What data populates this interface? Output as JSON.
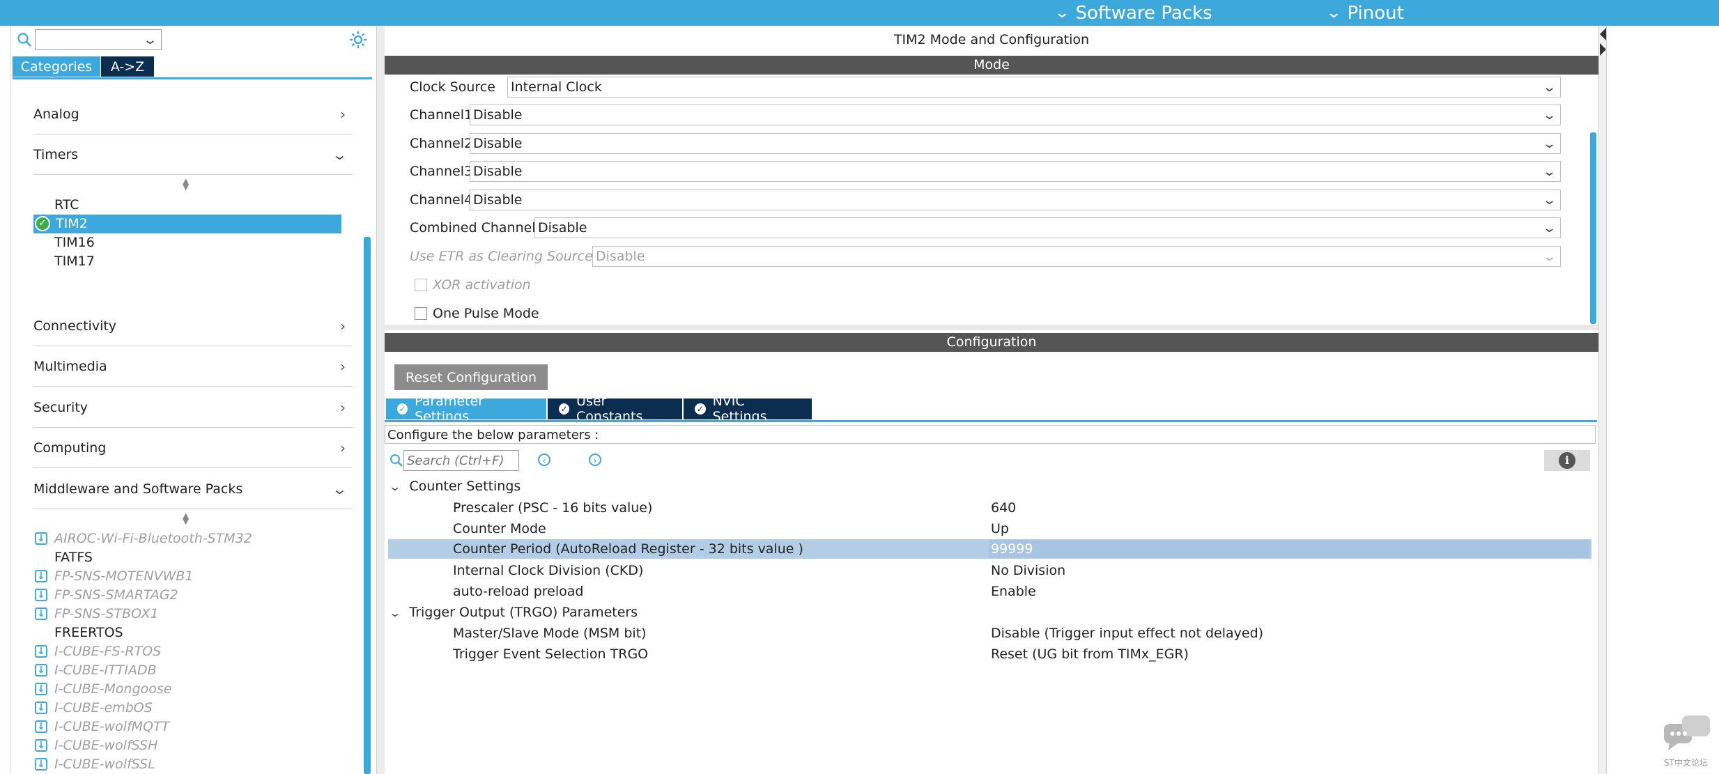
{
  "topbar": {
    "software_packs": "Software Packs",
    "pinout": "Pinout"
  },
  "left": {
    "search_placeholder": "",
    "tabs": {
      "categories": "Categories",
      "az": "A->Z"
    },
    "categories": {
      "analog": "Analog",
      "timers": "Timers",
      "connectivity": "Connectivity",
      "multimedia": "Multimedia",
      "security": "Security",
      "computing": "Computing",
      "middleware": "Middleware and Software Packs"
    },
    "timers_items": [
      "RTC",
      "TIM2",
      "TIM16",
      "TIM17"
    ],
    "middleware_items": [
      {
        "label": "AIROC-Wi-Fi-Bluetooth-STM32",
        "dim": true
      },
      {
        "label": "FATFS",
        "dim": false
      },
      {
        "label": "FP-SNS-MOTENVWB1",
        "dim": true
      },
      {
        "label": "FP-SNS-SMARTAG2",
        "dim": true
      },
      {
        "label": "FP-SNS-STBOX1",
        "dim": true
      },
      {
        "label": "FREERTOS",
        "dim": false
      },
      {
        "label": "I-CUBE-FS-RTOS",
        "dim": true
      },
      {
        "label": "I-CUBE-ITTIADB",
        "dim": true
      },
      {
        "label": "I-CUBE-Mongoose",
        "dim": true
      },
      {
        "label": "I-CUBE-embOS",
        "dim": true
      },
      {
        "label": "I-CUBE-wolfMQTT",
        "dim": true
      },
      {
        "label": "I-CUBE-wolfSSH",
        "dim": true
      },
      {
        "label": "I-CUBE-wolfSSL",
        "dim": true
      }
    ]
  },
  "main": {
    "title": "TIM2 Mode and Configuration",
    "mode_header": "Mode",
    "mode": {
      "clock_source_label": "Clock Source",
      "clock_source_value": "Internal Clock",
      "channel1_label": "Channel1",
      "channel1_value": "Disable",
      "channel2_label": "Channel2",
      "channel2_value": "Disable",
      "channel3_label": "Channel3",
      "channel3_value": "Disable",
      "channel4_label": "Channel4",
      "channel4_value": "Disable",
      "combined_label": "Combined Channels",
      "combined_value": "Disable",
      "etr_label": "Use ETR as Clearing Source",
      "etr_value": "Disable",
      "xor_label": "XOR activation",
      "one_pulse_label": "One Pulse Mode"
    },
    "config_header": "Configuration",
    "reset_button": "Reset Configuration",
    "tabs": {
      "parameter": "Parameter Settings",
      "user_constants": "User Constants",
      "nvic": "NVIC Settings"
    },
    "configure_text": "Configure the below parameters :",
    "search_placeholder": "Search (Ctrl+F)",
    "groups": {
      "counter": "Counter Settings",
      "trgo": "Trigger Output (TRGO) Parameters"
    },
    "counter_params": [
      {
        "name": "Prescaler (PSC - 16 bits value)",
        "value": "640"
      },
      {
        "name": "Counter Mode",
        "value": "Up"
      },
      {
        "name": "Counter Period (AutoReload Register - 32 bits value )",
        "value": "99999"
      },
      {
        "name": "Internal Clock Division (CKD)",
        "value": "No Division"
      },
      {
        "name": "auto-reload preload",
        "value": "Enable"
      }
    ],
    "trgo_params": [
      {
        "name": "Master/Slave Mode (MSM bit)",
        "value": "Disable (Trigger input effect not delayed)"
      },
      {
        "name": "Trigger Event Selection TRGO",
        "value": "Reset (UG bit from TIMx_EGR)"
      }
    ]
  },
  "watermark": "ST中文论坛",
  "colors": {
    "accent": "#3ca8dc",
    "tab_dark": "#0b2d4f",
    "selected_row": "#b3cde6",
    "header_gray": "#555555"
  }
}
